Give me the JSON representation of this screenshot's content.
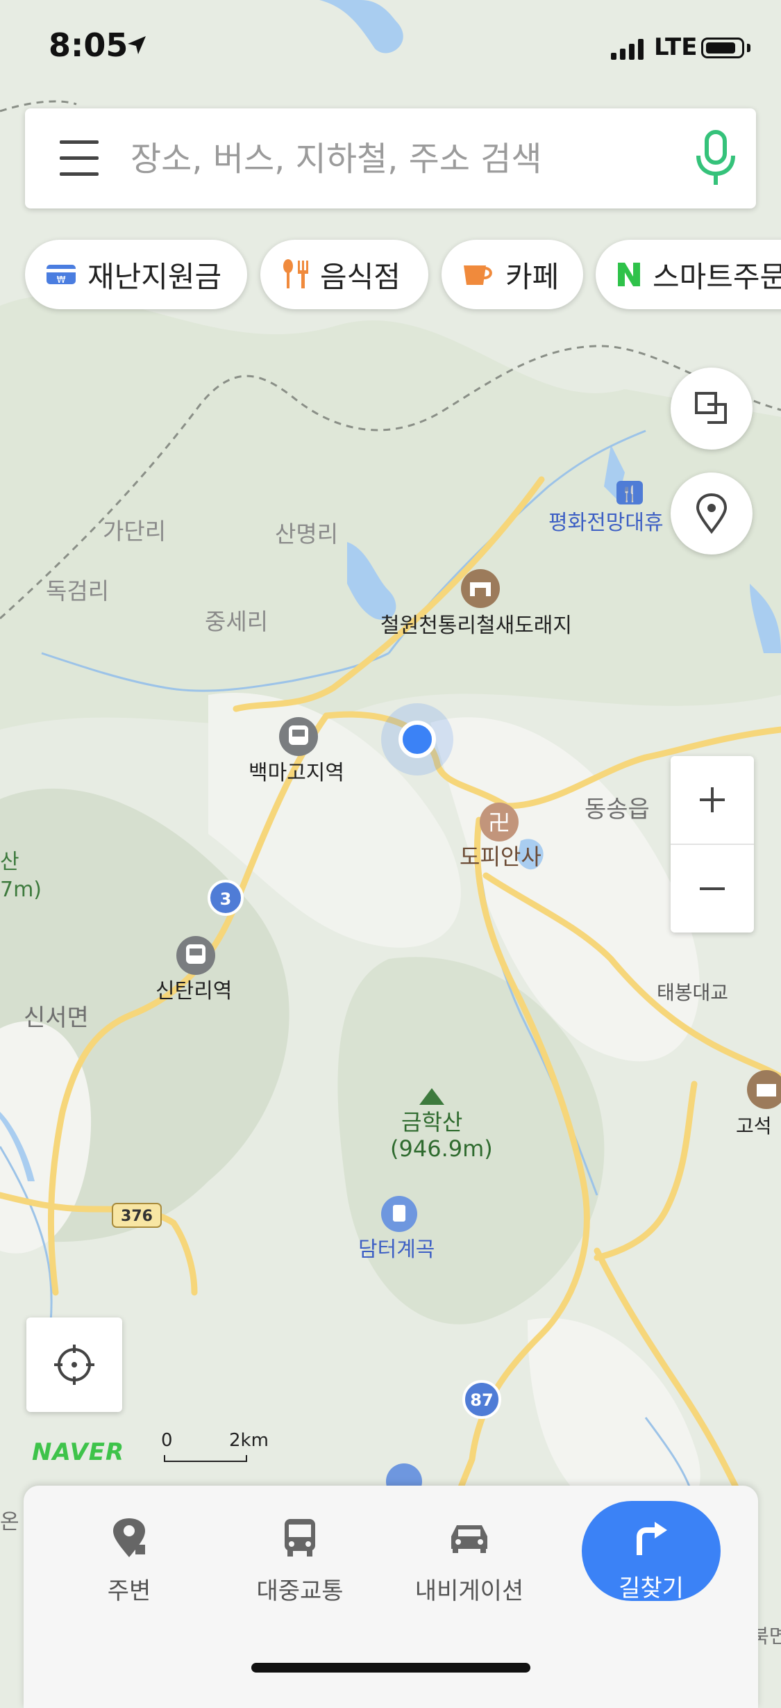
{
  "status_bar": {
    "time": "8:05",
    "network": "LTE"
  },
  "search": {
    "placeholder": "장소, 버스, 지하철, 주소 검색"
  },
  "chips": [
    {
      "label": "재난지원금",
      "icon": "card-icon"
    },
    {
      "label": "음식점",
      "icon": "utensils-icon"
    },
    {
      "label": "카페",
      "icon": "coffee-cup-icon"
    },
    {
      "label": "스마트주문",
      "icon": "naver-n-icon"
    }
  ],
  "map": {
    "places": {
      "peace_rest": "평화전망대휴",
      "gadanri": "가단리",
      "sanmyeongri": "산명리",
      "dokgeomri": "독검리",
      "jungseri": "중세리",
      "cheorwon_bird": "철원천통리철새도래지",
      "baekmagoji": "백마고지역",
      "dongsong": "동송읍",
      "dopiansa": "도피안사",
      "san_partial": "산",
      "m_partial": "7m)",
      "sintanri": "신탄리역",
      "sinseo": "신서면",
      "taebong": "태봉대교",
      "goseok": "고석",
      "geumhaksan": "금학산",
      "geumhaksan_elev": "(946.9m)",
      "damteo": "담터계곡",
      "bottom_right_partial": "북면",
      "bottom_left_partial": "온"
    },
    "roads": {
      "r3": "3",
      "r376": "376",
      "r87": "87"
    },
    "scale": {
      "zero": "0",
      "distance": "2km"
    },
    "logo": "NAVER"
  },
  "bottom_nav": {
    "items": [
      {
        "label": "주변",
        "icon": "location-pin-icon"
      },
      {
        "label": "대중교통",
        "icon": "bus-icon"
      },
      {
        "label": "내비게이션",
        "icon": "car-icon"
      },
      {
        "label": "길찾기",
        "icon": "turn-right-arrow-icon"
      }
    ]
  },
  "colors": {
    "accent": "#3b82f6",
    "naver_green": "#3ec34a",
    "road": "#f6d67a",
    "water": "#a9cdf0"
  }
}
